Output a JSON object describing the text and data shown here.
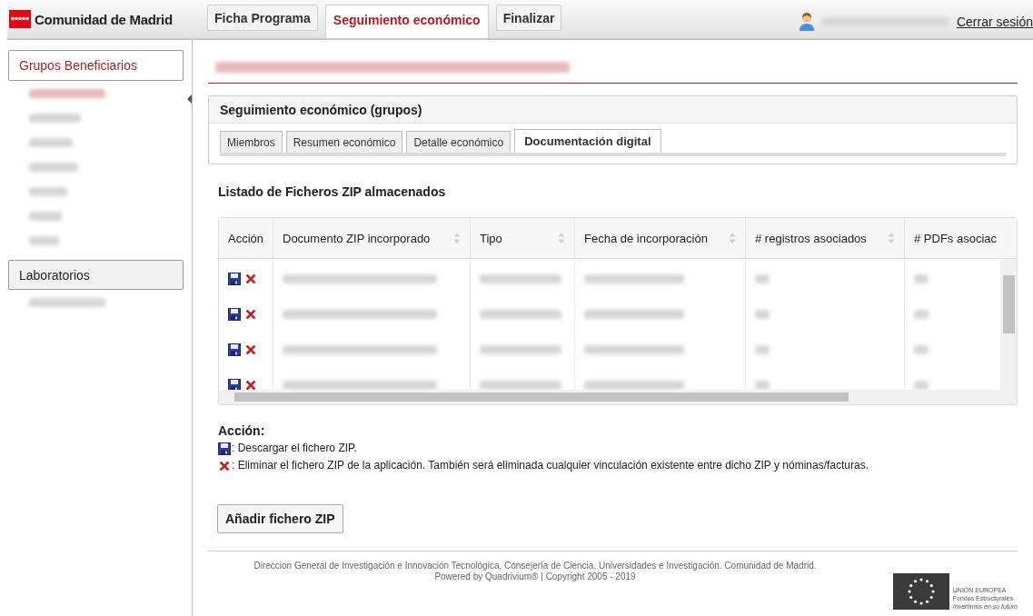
{
  "header": {
    "brand": "Comunidad de Madrid",
    "tabs": [
      {
        "label": "Ficha Programa",
        "selected": false
      },
      {
        "label": "Seguimiento económico",
        "selected": true
      },
      {
        "label": "Finalizar",
        "selected": false
      }
    ],
    "user": {
      "kind": "redacted"
    },
    "logout": "Cerrar sesión"
  },
  "sidebar": {
    "sections": [
      {
        "title": "Grupos Beneficiarios",
        "selected": true,
        "items": [
          {
            "kind": "redacted",
            "selected": true
          },
          {
            "kind": "redacted",
            "selected": false
          },
          {
            "kind": "redacted",
            "selected": false
          },
          {
            "kind": "redacted",
            "selected": false
          },
          {
            "kind": "redacted",
            "selected": false
          },
          {
            "kind": "redacted",
            "selected": false
          },
          {
            "kind": "redacted",
            "selected": false
          }
        ]
      },
      {
        "title": "Laboratorios",
        "selected": false,
        "items": [
          {
            "kind": "redacted",
            "selected": false
          }
        ]
      }
    ]
  },
  "page_title": {
    "kind": "redacted"
  },
  "panel": {
    "title": "Seguimiento económico (grupos)",
    "tabs": [
      {
        "label": "Miembros",
        "selected": false
      },
      {
        "label": "Resumen económico",
        "selected": false
      },
      {
        "label": "Detalle económico",
        "selected": false
      },
      {
        "label": "Documentación digital",
        "selected": true
      }
    ]
  },
  "list_title": "Listado de Ficheros ZIP almacenados",
  "table": {
    "columns": [
      {
        "label": "Acción",
        "sortable": false
      },
      {
        "label": "Documento ZIP incorporado",
        "sortable": true
      },
      {
        "label": "Tipo",
        "sortable": true
      },
      {
        "label": "Fecha de incorporación",
        "sortable": true
      },
      {
        "label": "# registros asociados",
        "sortable": true
      },
      {
        "label": "# PDFs asociac",
        "sortable": false
      }
    ],
    "rows": [
      {
        "kind": "redacted"
      },
      {
        "kind": "redacted"
      },
      {
        "kind": "redacted"
      },
      {
        "kind": "redacted"
      }
    ]
  },
  "legend": {
    "title": "Acción:",
    "items": [
      {
        "kind": "download",
        "text": ": Descargar el fichero ZIP."
      },
      {
        "kind": "delete",
        "text": ": Eliminar el fichero ZIP de la aplicación. También será eliminada cualquier vinculación existente entre dicho ZIP y nóminas/facturas."
      }
    ]
  },
  "add_button": "Añadir fichero ZIP",
  "footer": {
    "lines": [
      "Direccion General de Investigación e Innovación Tecnológica, Consejería de Ciencia, Universidades e Investigación. Comunidad de Madrid.",
      "Powered by Quadrivium® | Copyright 2005 - 2019"
    ],
    "eu": [
      "UNIÓN EUROPEA",
      "Fondos Estructurales",
      "Invertimos en su futuro"
    ]
  }
}
